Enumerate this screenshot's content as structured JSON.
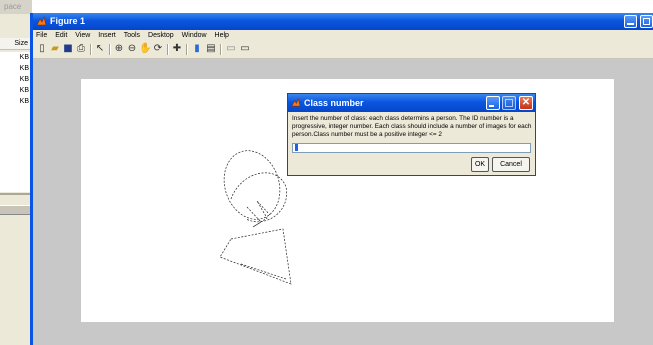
{
  "background": {
    "title": "pace",
    "column_header": "Size",
    "sizes": [
      "KB",
      "KB",
      "KB",
      "KB",
      "KB"
    ]
  },
  "figure": {
    "title": "Figure 1",
    "menu": [
      "File",
      "Edit",
      "View",
      "Insert",
      "Tools",
      "Desktop",
      "Window",
      "Help"
    ],
    "toolbar_icons": [
      "new-figure-icon",
      "open-file-icon",
      "save-icon",
      "print-icon",
      "edit-plot-arrow-icon",
      "zoom-in-icon",
      "zoom-out-icon",
      "pan-hand-icon",
      "rotate-3d-icon",
      "data-cursor-icon",
      "colorbar-icon",
      "legend-icon",
      "hide-plot-tools-icon",
      "show-plot-tools-icon"
    ]
  },
  "dialog": {
    "title": "Class number",
    "prompt": "Insert the number of class: each class determins a person. The ID number is a progressive, integer number. Each class should include a number of images for each person.Class number must be a positive integer <= 2",
    "input_value": "",
    "ok_label": "OK",
    "cancel_label": "Cancel"
  },
  "colors": {
    "xp_blue": "#0a56e0",
    "close_red": "#c43316",
    "figure_bg": "#c8c8c8",
    "face_bg": "#ece9d8"
  }
}
